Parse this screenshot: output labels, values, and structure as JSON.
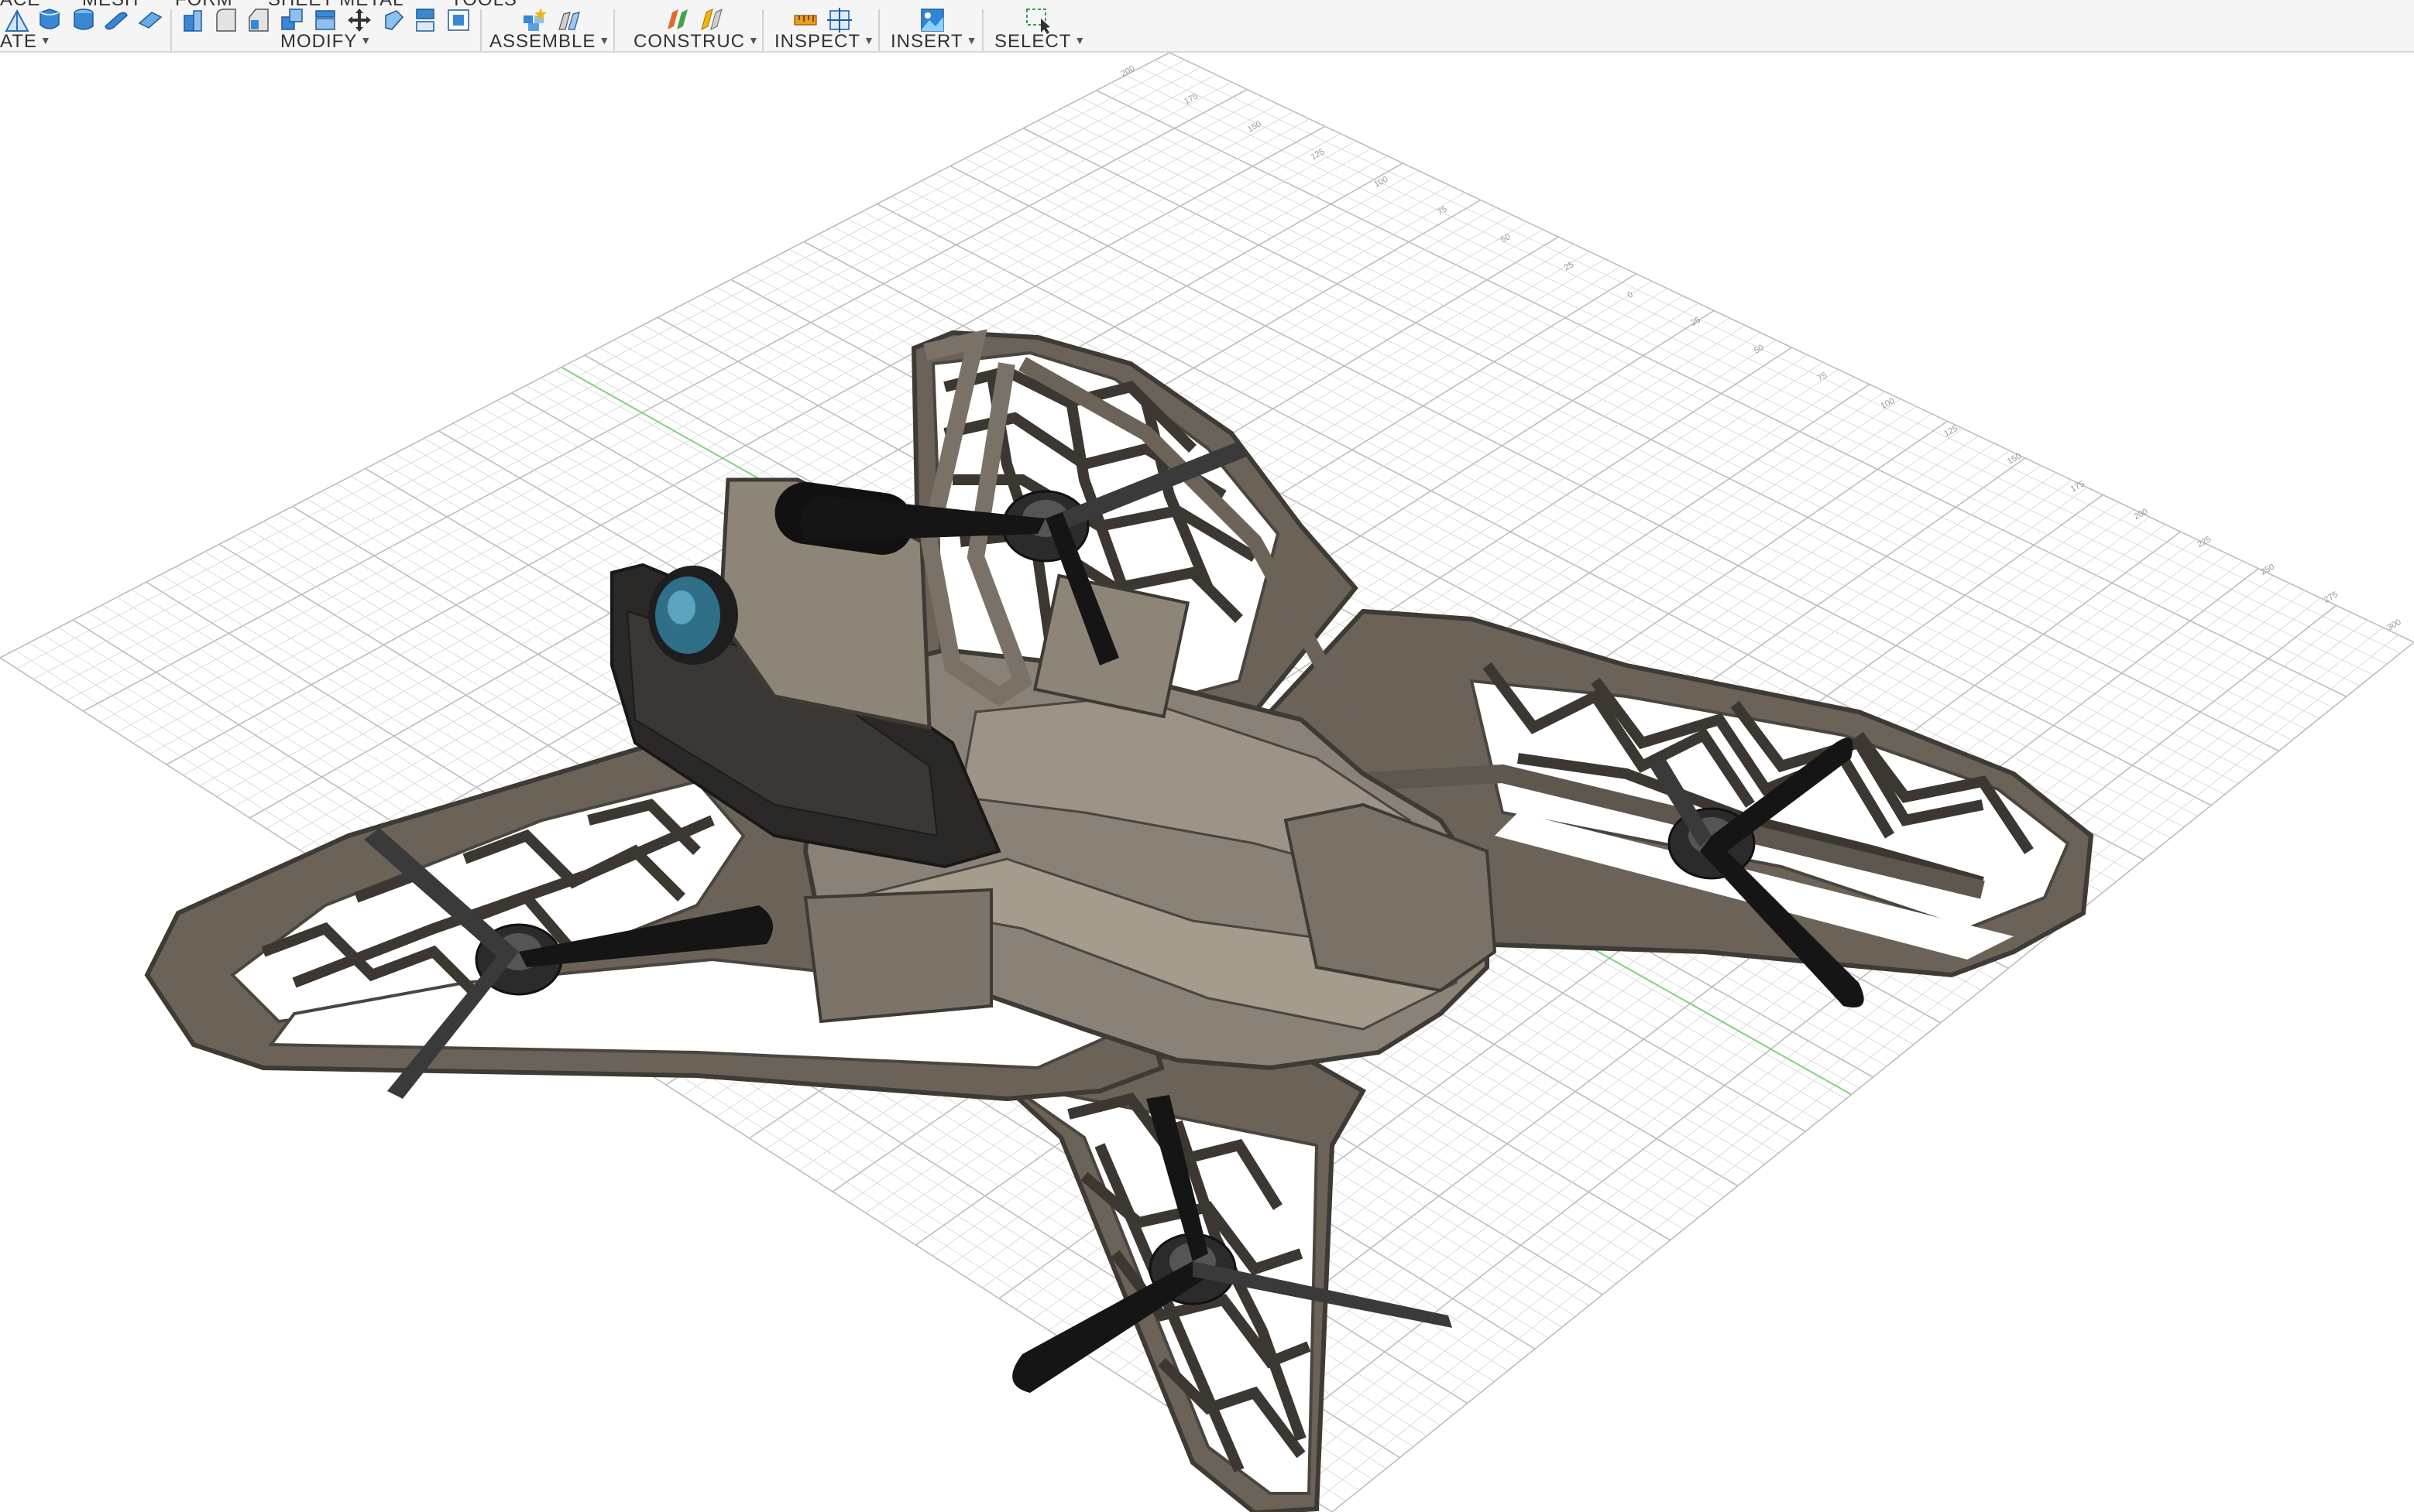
{
  "toolbar": {
    "tabs": [
      "ACE",
      "MESH",
      "FORM",
      "SHEET METAL",
      "TOOLS"
    ],
    "groups": {
      "create": "ATE",
      "modify": "MODIFY",
      "assemble": "ASSEMBLE",
      "construct": "CONSTRUC",
      "inspect": "INSPECT",
      "insert": "INSERT",
      "select": "SELECT"
    },
    "icons": {
      "create": [
        "triangle-sketch-icon",
        "box-icon",
        "cylinder-icon",
        "sphere-icon",
        "plane-icon"
      ],
      "modify": [
        "press-pull-icon",
        "fillet-icon",
        "chamfer-icon",
        "combine-icon",
        "shell-icon",
        "move-icon",
        "align-icon",
        "split-icon",
        "scale-icon"
      ],
      "assemble": [
        "new-component-icon",
        "joint-icon"
      ],
      "construct": [
        "offset-plane-icon",
        "midplane-icon"
      ],
      "inspect": [
        "measure-icon",
        "section-analysis-icon"
      ],
      "insert": [
        "insert-image-icon"
      ],
      "select": [
        "select-window-icon"
      ]
    }
  },
  "viewport": {
    "model": "quadcopter-drone-model",
    "grid_visible": true,
    "grid_labels": [
      "200",
      "175",
      "150",
      "125",
      "100",
      "75",
      "50",
      "25",
      "0",
      "25",
      "50",
      "75",
      "100",
      "125",
      "150",
      "175",
      "200",
      "225",
      "250",
      "275",
      "300"
    ],
    "colors": {
      "frame": "#6b6358",
      "frame_highlight": "#a59c8e",
      "body": "#8a8276",
      "propeller": "#151515",
      "camera_lens": "#2f6f88",
      "grid_line": "#d4d4d4",
      "grid_major": "#bdbdbd",
      "axis_x": "#7fd37f"
    }
  }
}
